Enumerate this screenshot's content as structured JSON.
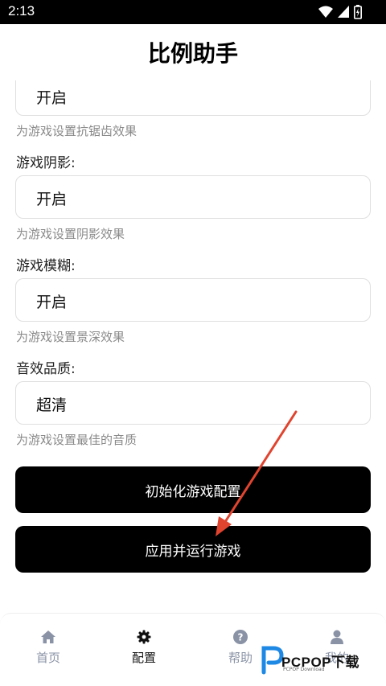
{
  "status": {
    "time": "2:13"
  },
  "header": {
    "title": "比例助手"
  },
  "fields": [
    {
      "label": "",
      "value": "开启",
      "hint": "为游戏设置抗锯齿效果"
    },
    {
      "label": "游戏阴影:",
      "value": "开启",
      "hint": "为游戏设置阴影效果"
    },
    {
      "label": "游戏模糊:",
      "value": "开启",
      "hint": "为游戏设置景深效果"
    },
    {
      "label": "音效品质:",
      "value": "超清",
      "hint": "为游戏设置最佳的音质"
    }
  ],
  "buttons": {
    "init_label": "初始化游戏配置",
    "apply_label": "应用并运行游戏"
  },
  "tabs": [
    {
      "label": "首页",
      "icon": "home-icon"
    },
    {
      "label": "配置",
      "icon": "gear-icon"
    },
    {
      "label": "帮助",
      "icon": "help-icon"
    },
    {
      "label": "我的",
      "icon": "user-icon"
    }
  ],
  "watermark": {
    "brand": "PCPOP下载",
    "sub": "PCPOP Download"
  },
  "colors": {
    "primary_button": "#000000",
    "annotation_arrow": "#e0442f",
    "tab_inactive": "#8a93a6"
  }
}
